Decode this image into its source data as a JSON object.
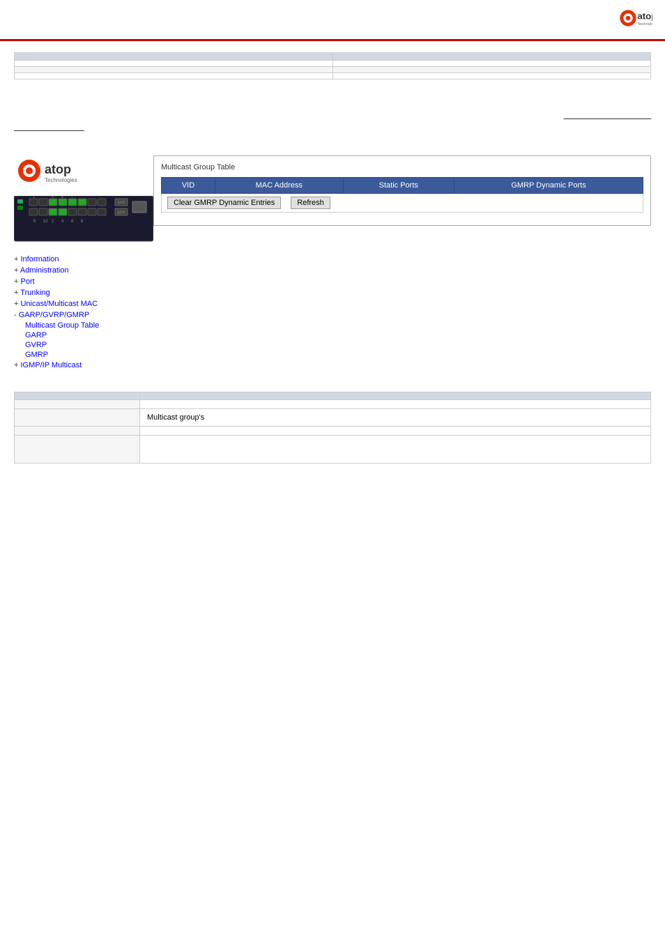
{
  "header": {
    "logo_brand": "atop",
    "logo_sub": "Technologies"
  },
  "top_table": {
    "headers": [
      "",
      ""
    ],
    "rows": [
      [
        "",
        ""
      ],
      [
        "",
        ""
      ],
      [
        "",
        ""
      ],
      [
        "",
        ""
      ]
    ]
  },
  "middle_text": {
    "line1": "",
    "line2": ""
  },
  "device": {
    "logo_brand": "atop",
    "logo_sub": "Technologies"
  },
  "nav": {
    "items": [
      {
        "label": "Information",
        "type": "plus"
      },
      {
        "label": "Administration",
        "type": "plus"
      },
      {
        "label": "Port",
        "type": "plus"
      },
      {
        "label": "Trunking",
        "type": "plus"
      },
      {
        "label": "Unicast/Multicast MAC",
        "type": "plus"
      },
      {
        "label": "GARP/GVRP/GMRP",
        "type": "minus"
      },
      {
        "label": "IGMP/IP Multicast",
        "type": "plus"
      }
    ],
    "sub_items": [
      "Multicast Group Table",
      "GARP",
      "GVRP",
      "GMRP"
    ]
  },
  "multicast_table": {
    "title": "Multicast Group Table",
    "columns": [
      "VID",
      "MAC Address",
      "Static Ports",
      "GMRP Dynamic Ports"
    ],
    "rows": [],
    "btn_clear": "Clear GMRP Dynamic Entries",
    "btn_refresh": "Refresh"
  },
  "bottom_table": {
    "rows": [
      {
        "label": "",
        "value": ""
      },
      {
        "label": "",
        "value": "Multicast group's"
      },
      {
        "label": "",
        "value": ""
      },
      {
        "label": "",
        "value": ""
      }
    ]
  }
}
